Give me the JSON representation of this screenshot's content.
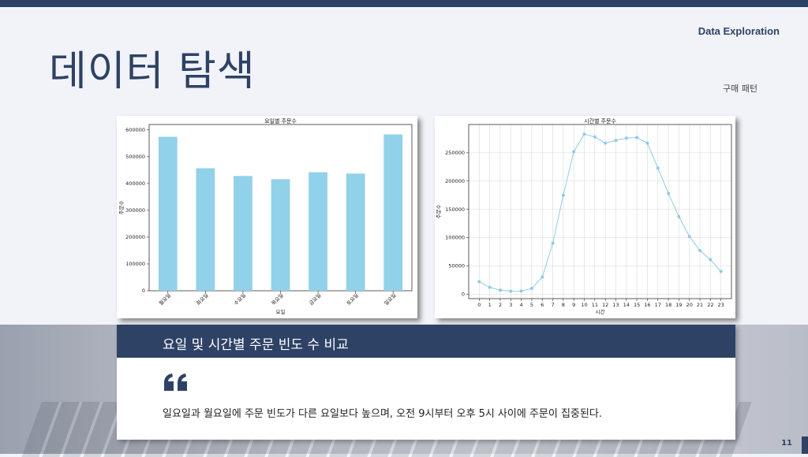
{
  "header": {
    "section_label": "Data Exploration",
    "title": "데이터 탐색",
    "subtitle": "구매 패턴"
  },
  "colors": {
    "accent": "#2e4266",
    "bar": "#92d1ea",
    "line": "#8ecbe6"
  },
  "chart_data": [
    {
      "type": "bar",
      "title": "요일별 주문수",
      "xlabel": "요일",
      "ylabel": "주문수",
      "categories": [
        "월요일",
        "화요일",
        "수요일",
        "목요일",
        "금요일",
        "토요일",
        "일요일"
      ],
      "values": [
        574000,
        457000,
        428000,
        416000,
        442000,
        437000,
        583000
      ],
      "ylim": [
        0,
        620000
      ],
      "yticks": [
        0,
        100000,
        200000,
        300000,
        400000,
        500000,
        600000
      ],
      "grid": false
    },
    {
      "type": "line",
      "title": "시간별 주문수",
      "xlabel": "시간",
      "ylabel": "주문수",
      "x": [
        0,
        1,
        2,
        3,
        4,
        5,
        6,
        7,
        8,
        9,
        10,
        11,
        12,
        13,
        14,
        15,
        16,
        17,
        18,
        19,
        20,
        21,
        22,
        23
      ],
      "values": [
        22000,
        12000,
        7000,
        5000,
        5500,
        10000,
        30000,
        90000,
        175000,
        252000,
        283000,
        278000,
        267000,
        272000,
        276000,
        277000,
        267000,
        223000,
        178000,
        137000,
        102000,
        77000,
        61000,
        40000
      ],
      "ylim": [
        -8000,
        300000
      ],
      "yticks": [
        0,
        50000,
        100000,
        150000,
        200000,
        250000
      ],
      "grid": true
    }
  ],
  "bottom": {
    "heading": "요일 및 시간별 주문 빈도 수 비교",
    "summary": "일요일과 월요일에 주문 빈도가 다른 요일보다 높으며, 오전 9시부터 오후 5시 사이에 주문이 집중된다."
  },
  "page_number": "11"
}
